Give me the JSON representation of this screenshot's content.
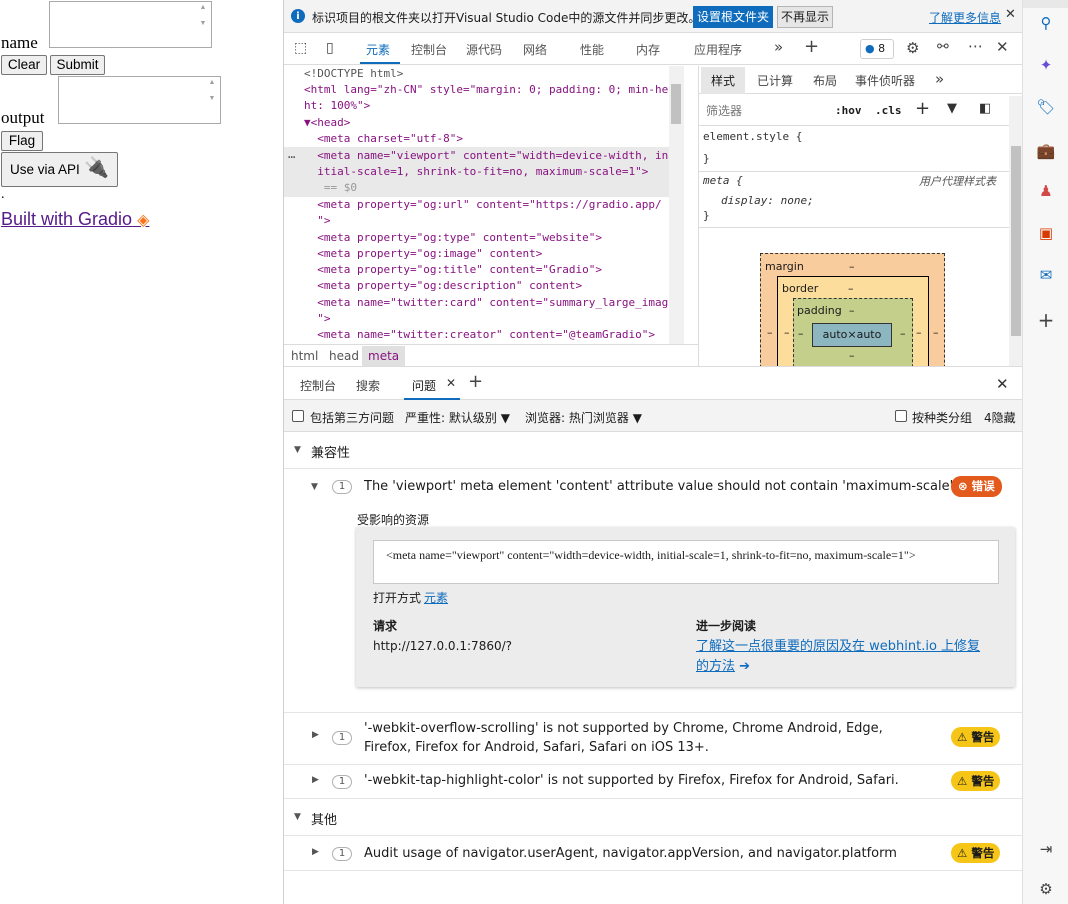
{
  "gradio": {
    "name_label": "name",
    "clear_label": "Clear",
    "submit_label": "Submit",
    "output_label": "output",
    "flag_label": "Flag",
    "api_label": "Use via API",
    "dot": ".",
    "built_label": "Built with Gradio"
  },
  "infobar": {
    "message": "标识项目的根文件夹以打开Visual Studio Code中的源文件并同步更改。",
    "set_root_button": "设置根文件夹",
    "dismiss_button": "不再显示",
    "learn_more": "了解更多信息"
  },
  "toolbar": {
    "tabs": [
      "元素",
      "控制台",
      "源代码",
      "网络",
      "性能",
      "内存",
      "应用程序"
    ],
    "issues_count": "8"
  },
  "elements": {
    "lines": [
      {
        "kind": "plain",
        "text": "<!DOCTYPE html>"
      },
      {
        "kind": "open",
        "text": "<html lang=\"zh-CN\" style=\"margin: 0; padding: 0; min-heig"
      },
      {
        "kind": "cont",
        "text": "ht: 100%\">"
      },
      {
        "kind": "open",
        "text": "▼<head>"
      },
      {
        "kind": "plain",
        "text": "  <meta charset=\"utf-8\">"
      },
      {
        "kind": "sel",
        "text": "  <meta name=\"viewport\" content=\"width=device-width, in"
      },
      {
        "kind": "sel",
        "text": "  itial-scale=1, shrink-to-fit=no, maximum-scale=1\">"
      },
      {
        "kind": "eq",
        "text": "   == $0"
      },
      {
        "kind": "plain",
        "text": "  <meta property=\"og:url\" content=\"https://gradio.app/"
      },
      {
        "kind": "plain",
        "text": "  \">"
      },
      {
        "kind": "plain",
        "text": "  <meta property=\"og:type\" content=\"website\">"
      },
      {
        "kind": "plain",
        "text": "  <meta property=\"og:image\" content>"
      },
      {
        "kind": "plain",
        "text": "  <meta property=\"og:title\" content=\"Gradio\">"
      },
      {
        "kind": "plain",
        "text": "  <meta property=\"og:description\" content>"
      },
      {
        "kind": "plain",
        "text": "  <meta name=\"twitter:card\" content=\"summary_large_image"
      },
      {
        "kind": "plain",
        "text": "  \">"
      },
      {
        "kind": "plain",
        "text": "  <meta name=\"twitter:creator\" content=\"@teamGradio\">"
      }
    ],
    "breadcrumbs": [
      "html",
      "head",
      "meta"
    ]
  },
  "styles": {
    "tabs": [
      "样式",
      "已计算",
      "布局",
      "事件侦听器"
    ],
    "filter_placeholder": "筛选器",
    "hov": ":hov",
    "cls": ".cls",
    "element_style": "element.style {",
    "close_brace": "}",
    "meta_selector": "meta {",
    "ua_label": "用户代理样式表",
    "display_rule": "display: none;",
    "box": {
      "margin": "margin",
      "border": "border",
      "padding": "padding",
      "content": "auto×auto",
      "dash": "–"
    }
  },
  "drawer": {
    "tabs": [
      "控制台",
      "搜索",
      "问题"
    ],
    "third_party": "包括第三方问题",
    "severity": "严重性: 默认级别",
    "browser": "浏览器: 热门浏览器",
    "group_by": "按种类分组",
    "hidden": "4隐藏"
  },
  "issues": {
    "compat_heading": "兼容性",
    "other_heading": "其他",
    "main_issue": "The 'viewport' meta element 'content' attribute value should not contain 'maximum-scale'.",
    "main_count": "1",
    "error_label": "错误",
    "affected": "受影响的资源",
    "code_snippet": "<meta name=\"viewport\" content=\"width=device-width, initial-scale=1, shrink-to-fit=no, maximum-scale=1\">",
    "open_in": "打开方式",
    "open_link": "元素",
    "request_heading": "请求",
    "request_url": "http://127.0.0.1:7860/?",
    "read_heading": "进一步阅读",
    "read_link": "了解这一点很重要的原因及在 webhint.io 上修复的方法",
    "warning_label": "警告",
    "others": [
      {
        "count": "1",
        "text": "'-webkit-overflow-scrolling' is not supported by Chrome, Chrome Android, Edge, Firefox, Firefox for Android, Safari, Safari on iOS 13+."
      },
      {
        "count": "1",
        "text": "'-webkit-tap-highlight-color' is not supported by Firefox, Firefox for Android, Safari."
      },
      {
        "count": "1",
        "text": "Audit usage of navigator.userAgent, navigator.appVersion, and navigator.platform"
      }
    ]
  }
}
